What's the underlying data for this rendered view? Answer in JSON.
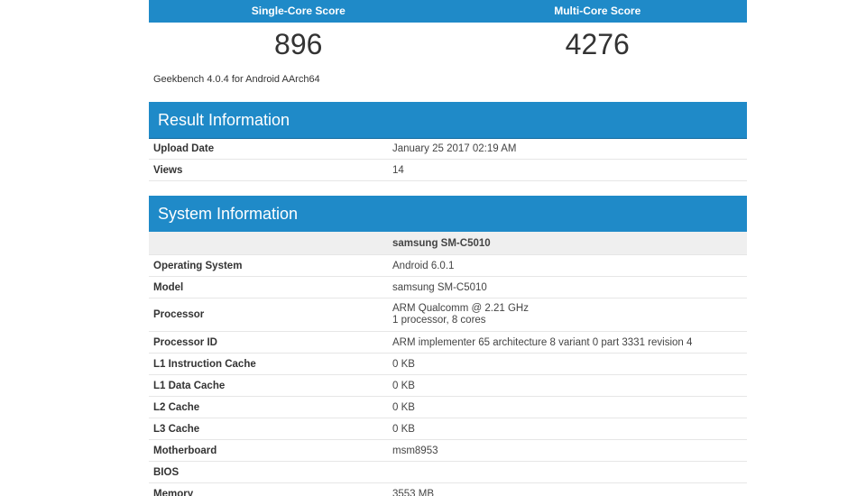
{
  "scores": {
    "single_core_label": "Single-Core Score",
    "multi_core_label": "Multi-Core Score",
    "single_core_value": "896",
    "multi_core_value": "4276",
    "version": "Geekbench 4.0.4 for Android AArch64"
  },
  "result_info": {
    "title": "Result Information",
    "rows": [
      {
        "label": "Upload Date",
        "value": "January 25 2017 02:19 AM"
      },
      {
        "label": "Views",
        "value": "14"
      }
    ]
  },
  "system_info": {
    "title": "System Information",
    "device": "samsung SM-C5010",
    "rows": [
      {
        "label": "Operating System",
        "value": "Android 6.0.1"
      },
      {
        "label": "Model",
        "value": "samsung SM-C5010"
      },
      {
        "label": "Processor",
        "value": "ARM Qualcomm @ 2.21 GHz",
        "value2": "1 processor, 8 cores"
      },
      {
        "label": "Processor ID",
        "value": "ARM implementer 65 architecture 8 variant 0 part 3331 revision 4"
      },
      {
        "label": "L1 Instruction Cache",
        "value": "0 KB"
      },
      {
        "label": "L1 Data Cache",
        "value": "0 KB"
      },
      {
        "label": "L2 Cache",
        "value": "0 KB"
      },
      {
        "label": "L3 Cache",
        "value": "0 KB"
      },
      {
        "label": "Motherboard",
        "value": "msm8953"
      },
      {
        "label": "BIOS",
        "value": ""
      },
      {
        "label": "Memory",
        "value": "3553 MB"
      }
    ]
  }
}
